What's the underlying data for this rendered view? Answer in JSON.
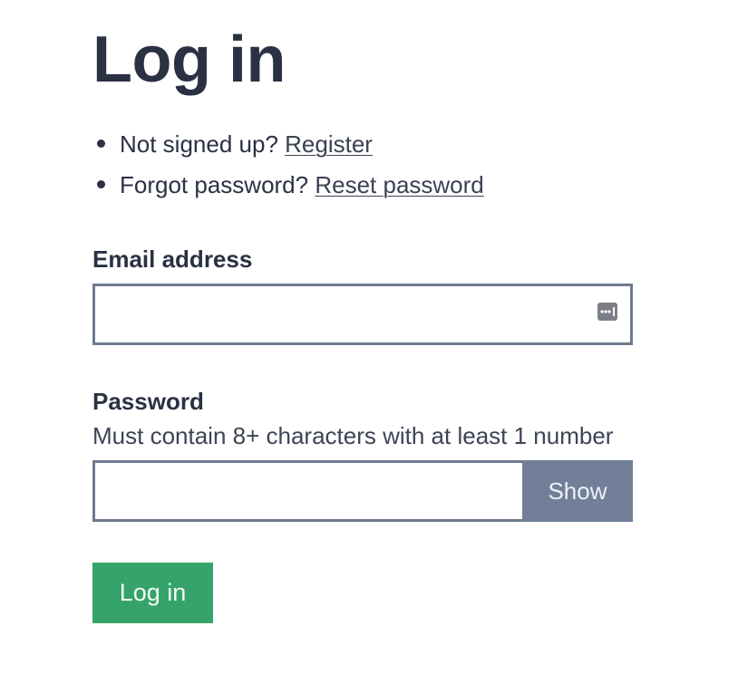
{
  "page": {
    "title": "Log in"
  },
  "links": [
    {
      "prompt": "Not signed up?",
      "link_text": "Register"
    },
    {
      "prompt": "Forgot password?",
      "link_text": "Reset password"
    }
  ],
  "email": {
    "label": "Email address",
    "value": "",
    "placeholder": "",
    "autofill_icon": "password-manager-icon"
  },
  "password": {
    "label": "Password",
    "hint": "Must contain 8+ characters with at least 1 number",
    "value": "",
    "placeholder": "",
    "show_label": "Show"
  },
  "submit": {
    "label": "Log in"
  },
  "colors": {
    "text": "#2a3142",
    "input_border": "#6e7a8e",
    "show_button_bg": "#717f98",
    "primary_button_bg": "#36a46a"
  }
}
